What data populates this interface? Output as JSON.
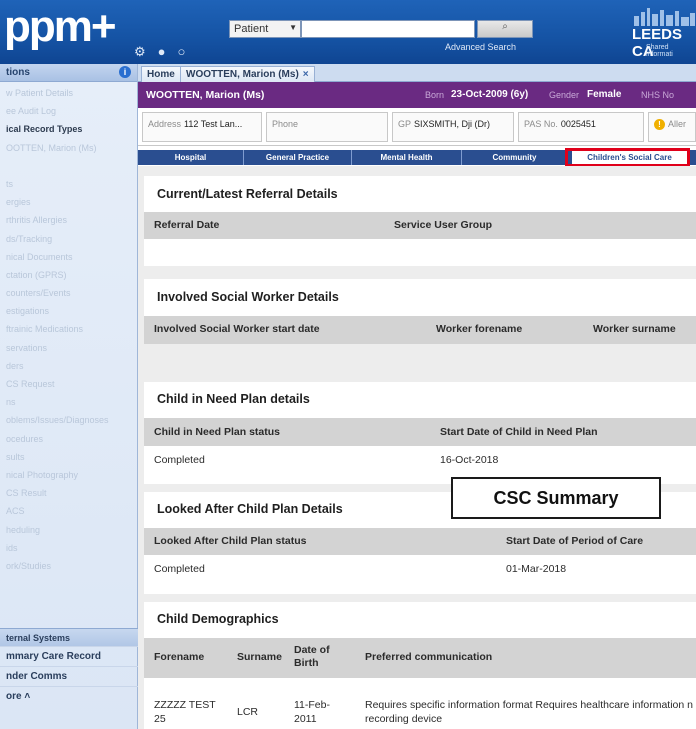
{
  "header": {
    "logo": "ppm+",
    "search_category": "Patient",
    "search_button": "⌕",
    "advanced_search": "Advanced Search",
    "org_name": "LEEDS CA",
    "org_sub": "Shared informati"
  },
  "sidebar": {
    "title": "tions",
    "items": [
      {
        "label": "w Patient Details",
        "dark": false
      },
      {
        "label": "ee Audit Log",
        "dark": false
      },
      {
        "label": "ical Record Types",
        "dark": true
      },
      {
        "label": "OOTTEN, Marion (Ms)",
        "dark": false
      },
      {
        "label": "",
        "dark": false
      },
      {
        "label": "ts",
        "dark": false
      },
      {
        "label": "ergies",
        "dark": false
      },
      {
        "label": "rthritis Allergies",
        "dark": false
      },
      {
        "label": "ds/Tracking",
        "dark": false
      },
      {
        "label": "nical Documents",
        "dark": false
      },
      {
        "label": "ctation (GPRS)",
        "dark": false
      },
      {
        "label": "counters/Events",
        "dark": false
      },
      {
        "label": "estigations",
        "dark": false
      },
      {
        "label": "ftrainic Medications",
        "dark": false
      },
      {
        "label": "servations",
        "dark": false
      },
      {
        "label": "ders",
        "dark": false
      },
      {
        "label": "CS Request",
        "dark": false
      },
      {
        "label": "ns",
        "dark": false
      },
      {
        "label": "oblems/Issues/Diagnoses",
        "dark": false
      },
      {
        "label": "ocedures",
        "dark": false
      },
      {
        "label": "sults",
        "dark": false
      },
      {
        "label": "nical Photography",
        "dark": false
      },
      {
        "label": "CS Result",
        "dark": false
      },
      {
        "label": "ACS",
        "dark": false
      },
      {
        "label": "heduling",
        "dark": false
      },
      {
        "label": "ids",
        "dark": false
      },
      {
        "label": "ork/Studies",
        "dark": false
      }
    ],
    "external_systems": "ternal Systems",
    "bottom_items": [
      "mmary Care Record",
      "nder Comms",
      "ore"
    ]
  },
  "tabs": {
    "home": "Home",
    "patient": "WOOTTEN, Marion (Ms)",
    "close": "×"
  },
  "banner": {
    "name": "WOOTTEN, Marion (Ms)",
    "born_label": "Born",
    "born_value": "23-Oct-2009 (6y)",
    "gender_label": "Gender",
    "gender_value": "Female",
    "nhs_label": "NHS No"
  },
  "details": {
    "address_label": "Address",
    "address_value": "112 Test Lan...",
    "phone_label": "Phone",
    "gp_label": "GP",
    "gp_value": "SIXSMITH, Dji (Dr)",
    "pas_label": "PAS No.",
    "pas_value": "0025451",
    "alert_label": "Aller"
  },
  "section_tabs": [
    "Hospital",
    "General Practice",
    "Mental Health",
    "Community",
    "Children's Social Care"
  ],
  "sections": {
    "referral": {
      "title": "Current/Latest Referral Details",
      "headers": [
        "Referral Date",
        "Service User Group"
      ]
    },
    "social_worker": {
      "title": "Involved Social Worker Details",
      "headers": [
        "Involved Social Worker start date",
        "Worker forename",
        "Worker surname"
      ]
    },
    "cin": {
      "title": "Child in Need Plan details",
      "headers": [
        "Child in Need Plan status",
        "Start Date of Child in Need Plan"
      ],
      "row": [
        "Completed",
        "16-Oct-2018"
      ]
    },
    "lac": {
      "title": "Looked After Child Plan Details",
      "headers": [
        "Looked After Child Plan status",
        "Start Date of Period of Care"
      ],
      "row": [
        "Completed",
        "01-Mar-2018"
      ]
    },
    "demographics": {
      "title": "Child Demographics",
      "headers": [
        "Forename",
        "Surname",
        "Date of Birth",
        "Preferred communication"
      ],
      "row": [
        "ZZZZZ TEST 25",
        "LCR",
        "11-Feb-2011",
        "Requires specific information format Requires healthcare information n recording device"
      ]
    }
  },
  "annotation": "CSC Summary",
  "colors": {
    "header_blue": "#1553a4",
    "banner_purple": "#6a2a82",
    "section_tab_blue": "#2a4e90",
    "highlight_red": "#e0001a"
  }
}
